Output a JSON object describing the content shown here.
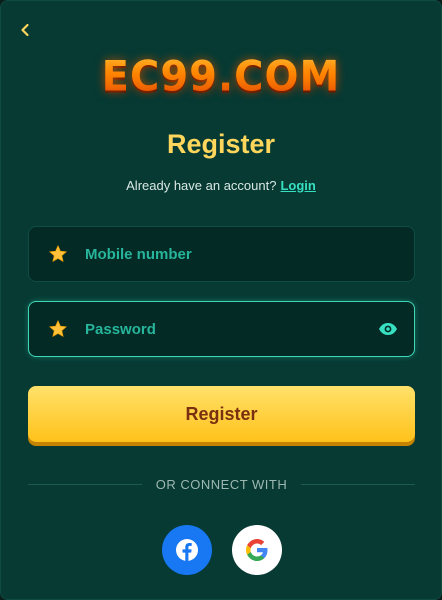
{
  "logo": {
    "text": "EC99.COM"
  },
  "header": {
    "title": "Register",
    "subtitle_text": "Already have an account?",
    "login_link": "Login"
  },
  "form": {
    "mobile": {
      "placeholder": "Mobile number",
      "value": ""
    },
    "password": {
      "placeholder": "Password",
      "value": ""
    },
    "submit_label": "Register"
  },
  "social": {
    "divider_text": "OR CONNECT WITH",
    "providers": [
      "facebook-icon",
      "google-icon"
    ]
  },
  "colors": {
    "background": "#063a33",
    "accent_yellow": "#ffd65c",
    "accent_teal": "#38e0c2",
    "facebook": "#1877f2"
  }
}
